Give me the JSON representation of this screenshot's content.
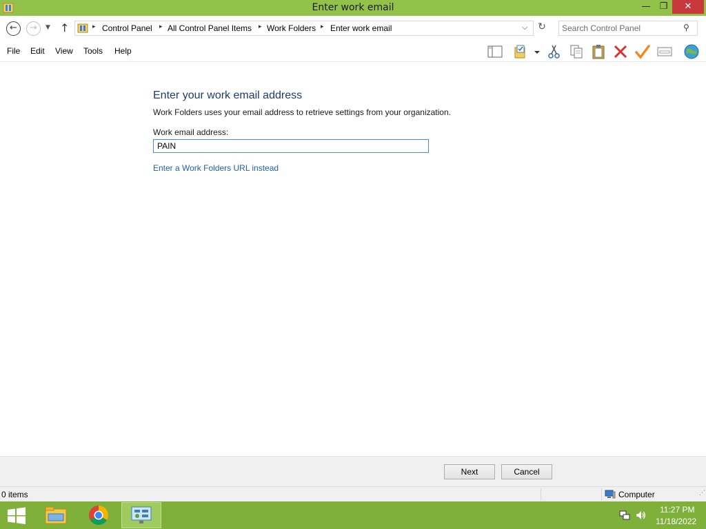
{
  "window": {
    "title": "Enter work email",
    "min_glyph": "—",
    "max_glyph": "❐",
    "close_glyph": "✕"
  },
  "address": {
    "crumbs": [
      "Control Panel",
      "All Control Panel Items",
      "Work Folders",
      "Enter work email"
    ],
    "separator": "▸",
    "search_placeholder": "Search Control Panel"
  },
  "menu": {
    "items": [
      "File",
      "Edit",
      "View",
      "Tools",
      "Help"
    ]
  },
  "toolbar": {
    "icons": [
      "preview-pane-icon",
      "folder-options-icon",
      "cut-icon",
      "copy-icon",
      "paste-icon",
      "delete-icon",
      "check-icon",
      "properties-icon",
      "globe-icon"
    ]
  },
  "content": {
    "heading": "Enter your work email address",
    "description": "Work Folders uses your email address to retrieve settings from your organization.",
    "field_label": "Work email address:",
    "field_value": "PAIN",
    "url_link": "Enter a Work Folders URL instead"
  },
  "buttons": {
    "next": "Next",
    "cancel": "Cancel"
  },
  "status": {
    "item_count": "0 items",
    "location": "Computer"
  },
  "taskbar": {
    "apps": [
      "file-explorer-icon",
      "chrome-icon",
      "control-panel-icon"
    ],
    "time": "11:27 PM",
    "date": "11/18/2022"
  },
  "colors": {
    "titlebar": "#93c24a",
    "taskbar": "#7fb03a",
    "close": "#c7393b",
    "heading": "#1e3a6e",
    "link": "#1e5fa8"
  }
}
